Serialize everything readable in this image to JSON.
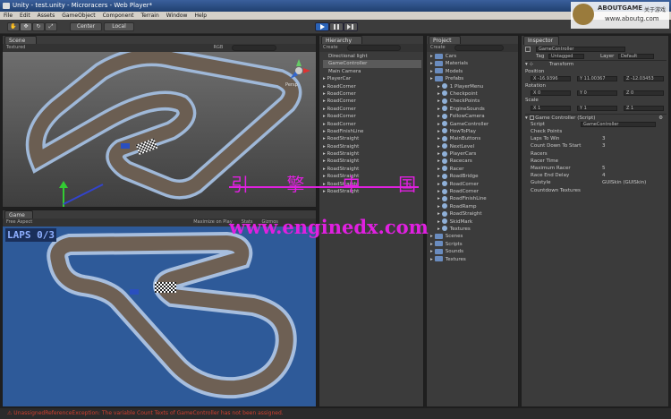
{
  "window": {
    "title": "Unity - test.unity - Microracers - Web Player*"
  },
  "menu": [
    "File",
    "Edit",
    "Assets",
    "GameObject",
    "Component",
    "Terrain",
    "Window",
    "Help"
  ],
  "toolbar": {
    "pivot": "Center",
    "space": "Local"
  },
  "scene": {
    "tab": "Scene",
    "mode": "Textured",
    "rgb": "RGB",
    "persp": "Persp"
  },
  "game": {
    "tab": "Game",
    "aspect": "Free Aspect",
    "maximize": "Maximize on Play",
    "stats": "Stats",
    "gizmos": "Gizmos",
    "laps_hud": "LAPS 0/3"
  },
  "hierarchy": {
    "tab": "Hierarchy",
    "create": "Create",
    "items": [
      "Directional light",
      "GameController",
      "Main Camera",
      "PlayerCar",
      "RoadCorner",
      "RoadCorner",
      "RoadCorner",
      "RoadCorner",
      "RoadCorner",
      "RoadCorner",
      "RoadFinishLine",
      "RoadStraight",
      "RoadStraight",
      "RoadStraight",
      "RoadStraight",
      "RoadStraight",
      "RoadStraight",
      "RoadStraight",
      "RoadStraight"
    ]
  },
  "project": {
    "tab": "Project",
    "create": "Create",
    "items": [
      {
        "name": "Cars",
        "level": 0,
        "folder": true
      },
      {
        "name": "Materials",
        "level": 0,
        "folder": true
      },
      {
        "name": "Models",
        "level": 0,
        "folder": true
      },
      {
        "name": "Prefabs",
        "level": 0,
        "folder": true
      },
      {
        "name": "1 PlayerMenu",
        "level": 1,
        "folder": false
      },
      {
        "name": "Checkpoint",
        "level": 1,
        "folder": false
      },
      {
        "name": "CheckPoints",
        "level": 1,
        "folder": false
      },
      {
        "name": "EngineSounds",
        "level": 1,
        "folder": false
      },
      {
        "name": "FollowCamera",
        "level": 1,
        "folder": false
      },
      {
        "name": "GameController",
        "level": 1,
        "folder": false
      },
      {
        "name": "HowToPlay",
        "level": 1,
        "folder": false
      },
      {
        "name": "MainButtons",
        "level": 1,
        "folder": false
      },
      {
        "name": "NextLevel",
        "level": 1,
        "folder": false
      },
      {
        "name": "PlayerCars",
        "level": 1,
        "folder": false
      },
      {
        "name": "Racecars",
        "level": 1,
        "folder": false
      },
      {
        "name": "Racer",
        "level": 1,
        "folder": false
      },
      {
        "name": "RoadBridge",
        "level": 1,
        "folder": false
      },
      {
        "name": "RoadCorner",
        "level": 1,
        "folder": false
      },
      {
        "name": "RoadCorner",
        "level": 1,
        "folder": false
      },
      {
        "name": "RoadFinishLine",
        "level": 1,
        "folder": false
      },
      {
        "name": "RoadRamp",
        "level": 1,
        "folder": false
      },
      {
        "name": "RoadStraight",
        "level": 1,
        "folder": false
      },
      {
        "name": "SkidMark",
        "level": 1,
        "folder": false
      },
      {
        "name": "Textures",
        "level": 1,
        "folder": false
      },
      {
        "name": "Scenes",
        "level": 0,
        "folder": true
      },
      {
        "name": "Scripts",
        "level": 0,
        "folder": true
      },
      {
        "name": "Sounds",
        "level": 0,
        "folder": true
      },
      {
        "name": "Textures",
        "level": 0,
        "folder": true
      }
    ]
  },
  "inspector": {
    "tab": "Inspector",
    "object_name": "GameController",
    "tag_label": "Tag",
    "tag_value": "Untagged",
    "layer_label": "Layer",
    "layer_value": "Default",
    "transform": "Transform",
    "position_label": "Position",
    "position": [
      "X -16.9396",
      "Y 11.00367",
      "Z -12.03453"
    ],
    "rotation_label": "Rotation",
    "rotation": [
      "X 0",
      "Y 0",
      "Z 0"
    ],
    "scale_label": "Scale",
    "scale": [
      "X 1",
      "Y 1",
      "Z 1"
    ],
    "script_component": "Game Controller (Script)",
    "script_label": "Script",
    "script_value": "GameController",
    "props": [
      {
        "label": "Check Points",
        "value": ""
      },
      {
        "label": "Laps To Win",
        "value": "3"
      },
      {
        "label": "Count Down To Start",
        "value": "3"
      },
      {
        "label": "Racers",
        "value": ""
      },
      {
        "label": "Racer Time",
        "value": ""
      },
      {
        "label": "Maximum Racer",
        "value": "5"
      },
      {
        "label": "Race End Delay",
        "value": "4"
      },
      {
        "label": "Guistyle",
        "value": "GUISkin (GUISkin)"
      },
      {
        "label": "Countdown Textures",
        "value": ""
      }
    ]
  },
  "status": {
    "message": "UnassignedReferenceException: The variable Count Texts of GameController has not been assigned."
  },
  "watermark": {
    "logo": "ABOUTGAME",
    "logo_sub": "关于游戏",
    "url": "www.aboutg.com",
    "cn": "引 擎 中 国",
    "site": "www.enginedx.com"
  },
  "colors": {
    "statusError": "#d04030",
    "accent": "#3a74c4"
  }
}
